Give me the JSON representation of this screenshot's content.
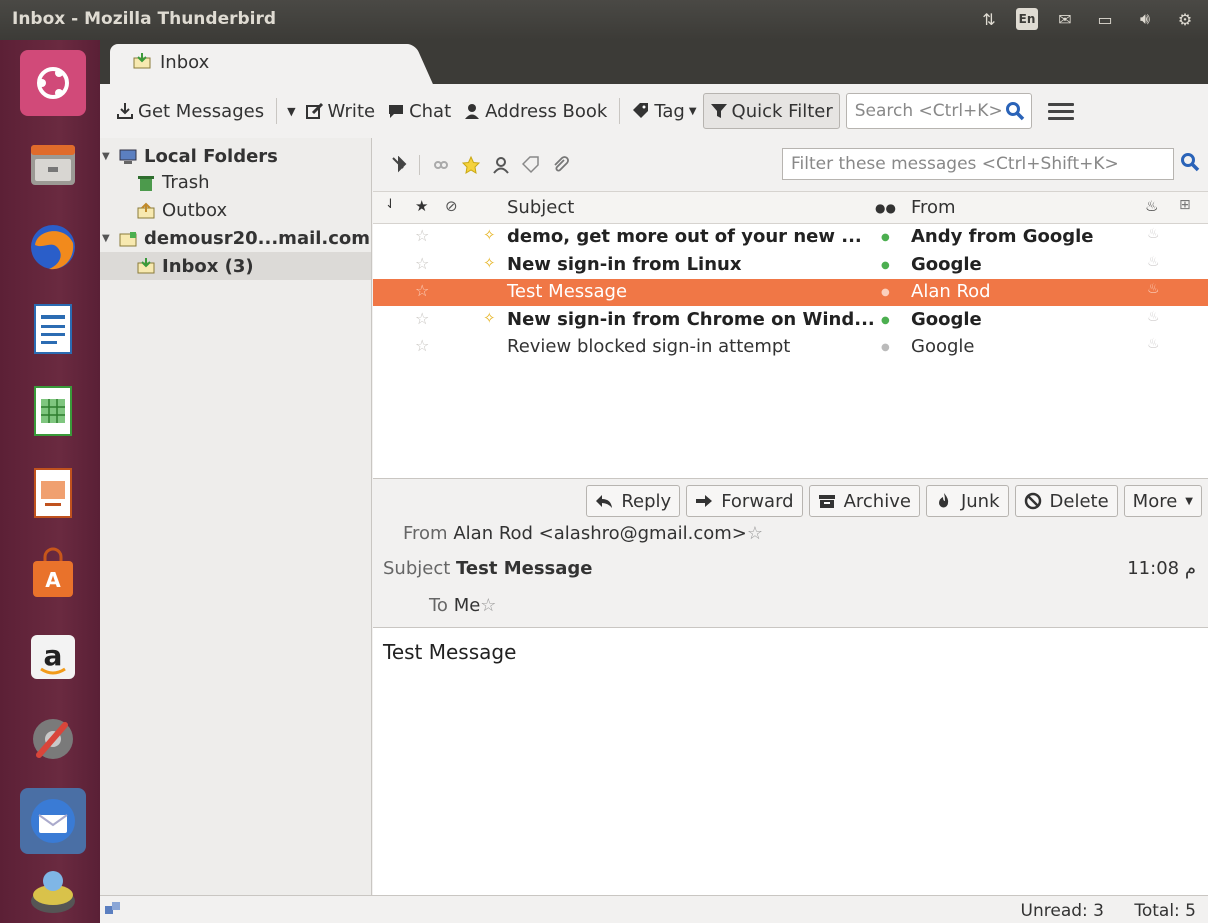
{
  "window": {
    "title": "Inbox - Mozilla Thunderbird"
  },
  "tray": {
    "keyboard": "En"
  },
  "tab": {
    "label": "Inbox"
  },
  "toolbar": {
    "get_messages": "Get Messages",
    "write": "Write",
    "chat": "Chat",
    "address_book": "Address Book",
    "tag": "Tag",
    "quick_filter": "Quick Filter",
    "search_placeholder": "Search <Ctrl+K>"
  },
  "folders": {
    "local": "Local Folders",
    "trash": "Trash",
    "outbox": "Outbox",
    "account": "demousr20...mail.com",
    "inbox": "Inbox (3)"
  },
  "quickfilter": {
    "placeholder": "Filter these messages <Ctrl+Shift+K>"
  },
  "columns": {
    "subject": "Subject",
    "from": "From"
  },
  "messages": [
    {
      "subject": "demo, get more out of your new ...",
      "from": "Andy from Google",
      "unread": true,
      "state": "unread"
    },
    {
      "subject": "New sign-in from Linux",
      "from": "Google",
      "unread": true,
      "state": "unread"
    },
    {
      "subject": "Test Message",
      "from": "Alan Rod",
      "unread": false,
      "state": "selected"
    },
    {
      "subject": "New sign-in from Chrome on Wind...",
      "from": "Google",
      "unread": true,
      "state": "unread"
    },
    {
      "subject": "Review blocked sign-in attempt",
      "from": "Google",
      "unread": false,
      "state": "read"
    }
  ],
  "actions": {
    "reply": "Reply",
    "forward": "Forward",
    "archive": "Archive",
    "junk": "Junk",
    "delete": "Delete",
    "more": "More"
  },
  "header": {
    "from_label": "From",
    "from_value": "Alan Rod <alashro@gmail.com>",
    "subject_label": "Subject",
    "subject_value": "Test Message",
    "to_label": "To",
    "to_value": "Me",
    "time": "11:08 م"
  },
  "body": {
    "text": "Test Message"
  },
  "status": {
    "unread": "Unread: 3",
    "total": "Total: 5"
  },
  "colors": {
    "selection": "#f07746",
    "launcher": "#5e2339",
    "titlebar": "#3c3b37"
  }
}
